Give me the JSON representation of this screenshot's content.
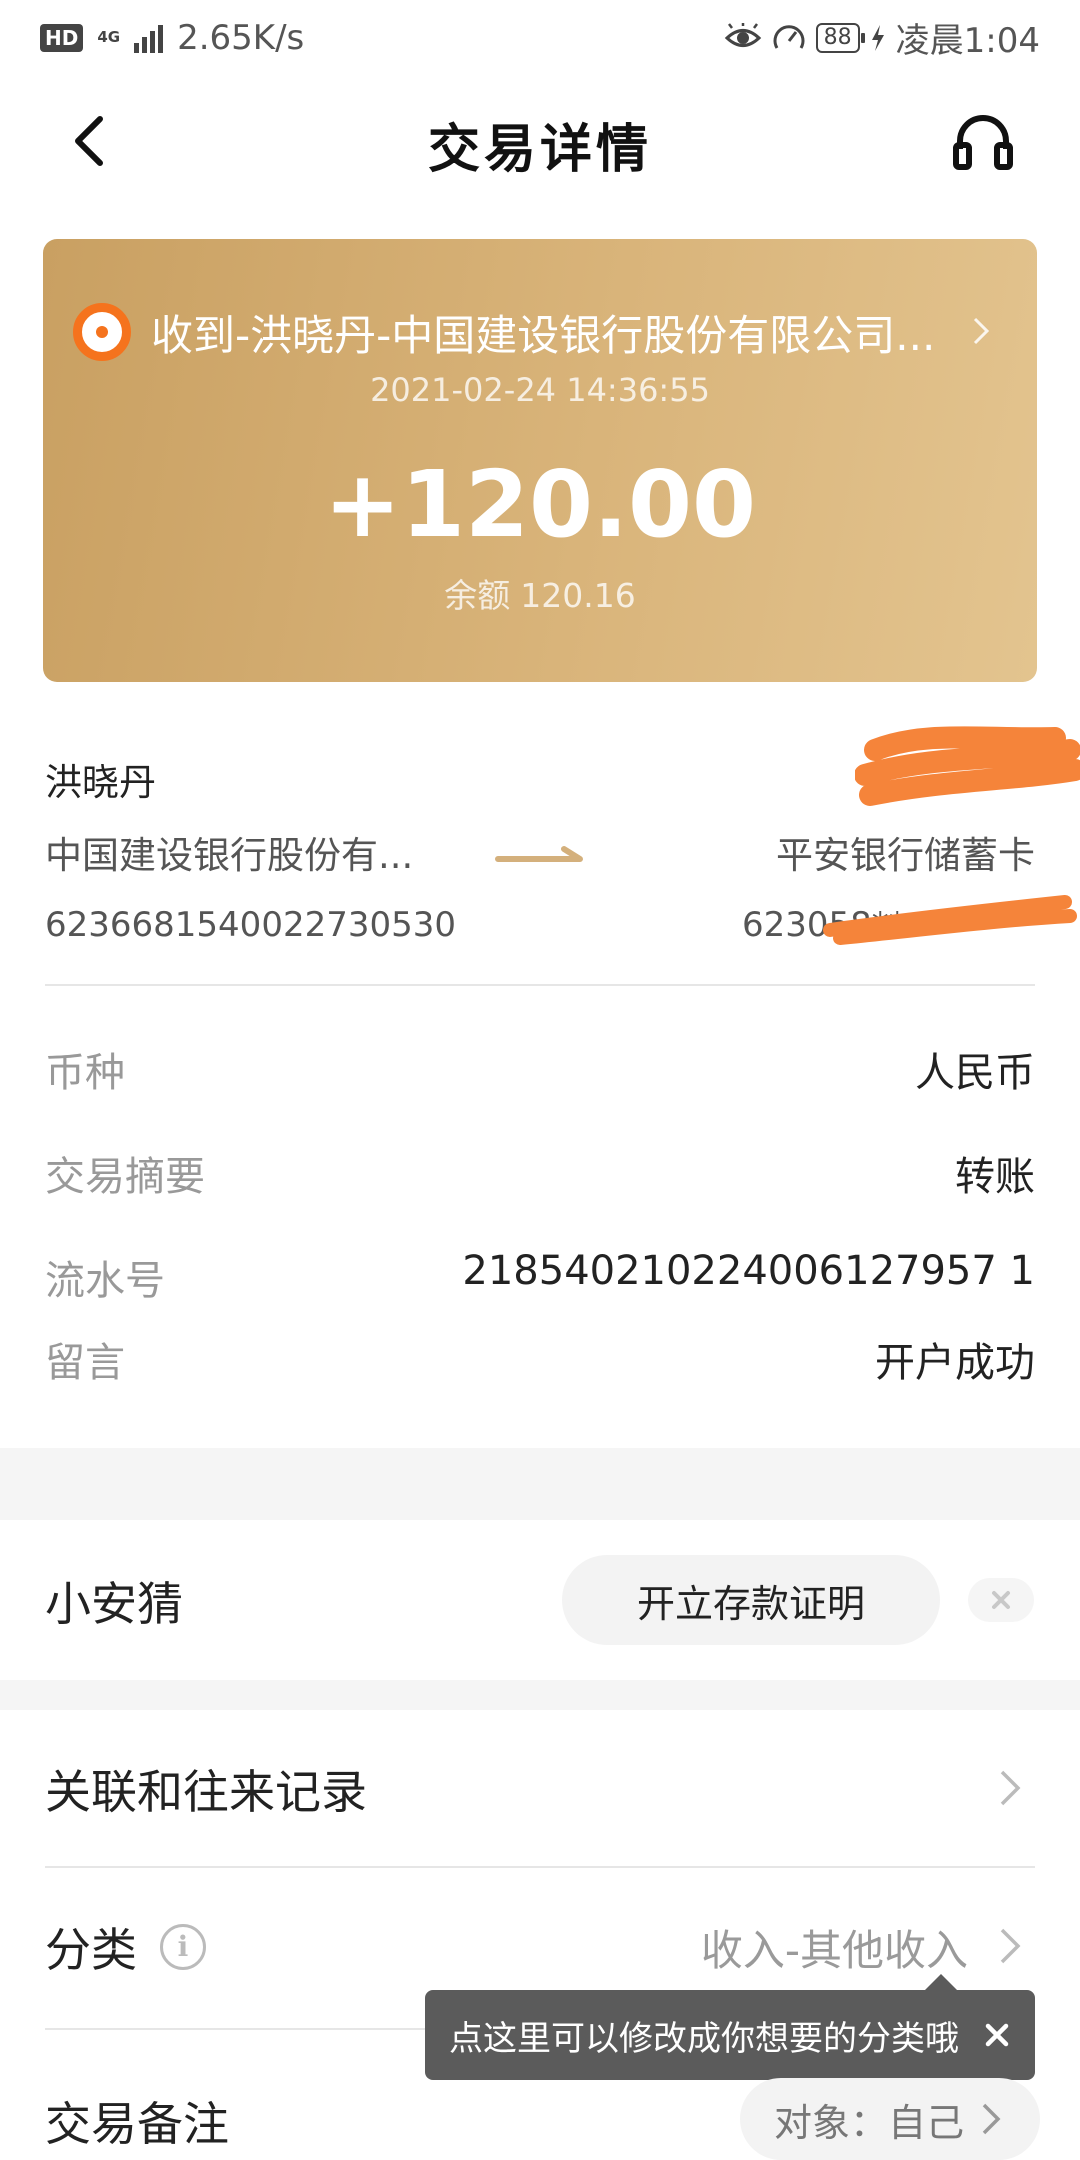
{
  "status_bar": {
    "hd": "HD",
    "network": "4G",
    "speed": "2.65K/s",
    "battery": "88",
    "time": "凌晨1:04"
  },
  "nav": {
    "title": "交易详情"
  },
  "summary": {
    "headline": "收到-洪晓丹-中国建设银行股份有限公司...",
    "datetime": "2021-02-24 14:36:55",
    "amount": "+120.00",
    "balance_label": "余额",
    "balance_value": "120.16"
  },
  "transfer": {
    "from_name": "洪晓丹",
    "from_bank": "中国建设银行股份有...",
    "from_account": "6236681540022730530",
    "to_bank": "平安银行储蓄卡",
    "to_account_prefix": "623058**"
  },
  "details": [
    {
      "label": "币种",
      "value": "人民币"
    },
    {
      "label": "交易摘要",
      "value": "转账"
    },
    {
      "label": "流水号",
      "value": "218540210224006127957 1"
    },
    {
      "label": "留言",
      "value": "开户成功"
    }
  ],
  "xiaoan": {
    "title": "小安猜",
    "button": "开立存款证明"
  },
  "links": {
    "related_records": "关联和往来记录",
    "category_label": "分类",
    "category_info_glyph": "i",
    "category_value": "收入-其他收入",
    "remark_label": "交易备注",
    "remark_object": "对象：自己"
  },
  "tooltip": {
    "text": "点这里可以修改成你想要的分类哦"
  },
  "colors": {
    "card_gold": "#d4ad70",
    "brand_orange": "#f5731d",
    "tooltip_bg": "#5b5b5b"
  }
}
